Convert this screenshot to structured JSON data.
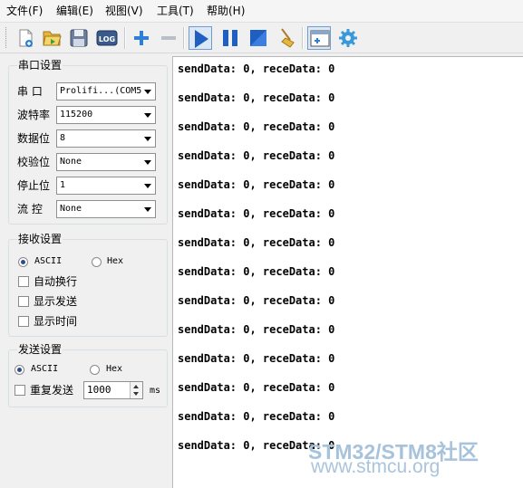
{
  "menu": [
    "文件(F)",
    "编辑(E)",
    "视图(V)",
    "工具(T)",
    "帮助(H)"
  ],
  "toolbar": {
    "icons": [
      "new-file-icon",
      "open-folder-icon",
      "save-icon",
      "log-icon",
      "add-icon",
      "remove-icon",
      "play-icon",
      "pause-icon",
      "stop-icon",
      "clear-broom-icon",
      "window-add-icon",
      "settings-gear-icon"
    ],
    "log_label": "LOG"
  },
  "serial_settings": {
    "title": "串口设置",
    "fields": [
      {
        "label": "串  口",
        "value": "Prolifi...(COM5"
      },
      {
        "label": "波特率",
        "value": "115200"
      },
      {
        "label": "数据位",
        "value": "8"
      },
      {
        "label": "校验位",
        "value": "None"
      },
      {
        "label": "停止位",
        "value": "1"
      },
      {
        "label": "流  控",
        "value": "None"
      }
    ]
  },
  "receive_settings": {
    "title": "接收设置",
    "mode_ascii": "ASCII",
    "mode_hex": "Hex",
    "selected_mode": "ASCII",
    "checkboxes": [
      {
        "label": "自动换行",
        "checked": false
      },
      {
        "label": "显示发送",
        "checked": false
      },
      {
        "label": "显示时间",
        "checked": false
      }
    ]
  },
  "send_settings": {
    "title": "发送设置",
    "mode_ascii": "ASCII",
    "mode_hex": "Hex",
    "selected_mode": "ASCII",
    "repeat_label": "重复发送",
    "repeat_checked": false,
    "interval_value": "1000",
    "interval_unit": "ms"
  },
  "receive_area": {
    "lines": [
      "sendData: 0, receData: 0",
      "sendData: 0, receData: 0",
      "sendData: 0, receData: 0",
      "sendData: 0, receData: 0",
      "sendData: 0, receData: 0",
      "sendData: 0, receData: 0",
      "sendData: 0, receData: 0",
      "sendData: 0, receData: 0",
      "sendData: 0, receData: 0",
      "sendData: 0, receData: 0",
      "sendData: 0, receData: 0",
      "sendData: 0, receData: 0",
      "sendData: 0, receData: 0",
      "sendData: 0, receData: 0"
    ]
  },
  "watermark": {
    "line1": "STM32/STM8社区",
    "line2": "www.stmcu.org"
  },
  "colors": {
    "accent_blue": "#1f5fbf",
    "watermark": "#a7c3dc"
  }
}
